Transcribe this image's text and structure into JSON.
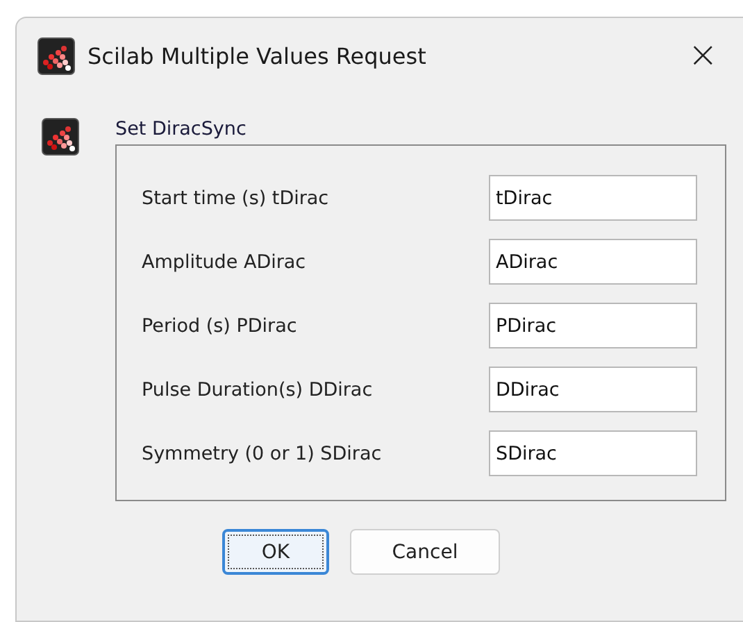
{
  "window": {
    "title": "Scilab Multiple Values Request",
    "close": "×"
  },
  "group": {
    "title": "Set DiracSync"
  },
  "fields": [
    {
      "label": "Start time (s) tDirac",
      "value": "tDirac"
    },
    {
      "label": "Amplitude ADirac",
      "value": "ADirac"
    },
    {
      "label": "Period (s) PDirac",
      "value": "PDirac"
    },
    {
      "label": "Pulse Duration(s) DDirac",
      "value": "DDirac"
    },
    {
      "label": "Symmetry (0 or 1) SDirac",
      "value": "SDirac"
    }
  ],
  "buttons": [
    {
      "label": "OK",
      "focused": true
    },
    {
      "label": "Cancel",
      "focused": false
    }
  ]
}
